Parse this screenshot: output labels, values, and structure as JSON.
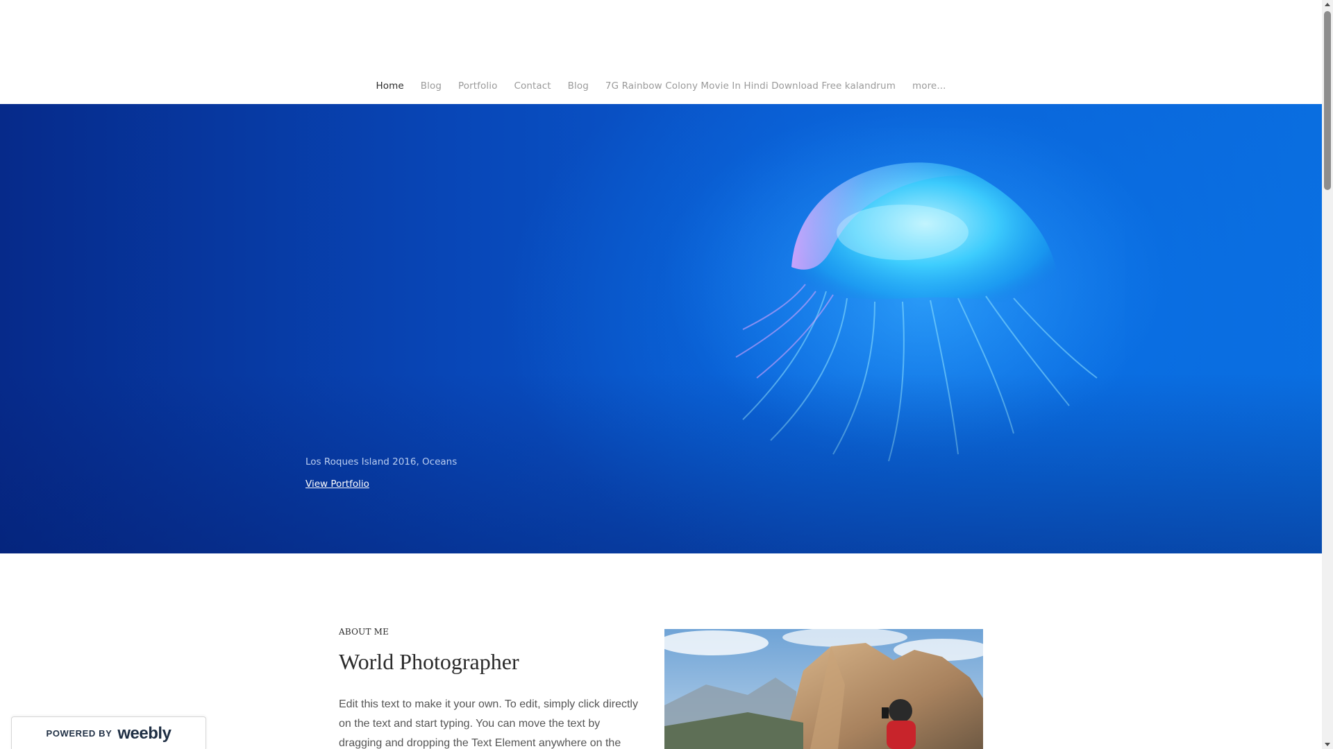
{
  "nav": {
    "items": [
      {
        "label": "Home",
        "active": true
      },
      {
        "label": "Blog",
        "active": false
      },
      {
        "label": "Portfolio",
        "active": false
      },
      {
        "label": "Contact",
        "active": false
      },
      {
        "label": "Blog",
        "active": false
      },
      {
        "label": "7G Rainbow Colony Movie In Hindi Download Free kalandrum",
        "active": false
      },
      {
        "label": "more...",
        "active": false
      }
    ]
  },
  "hero": {
    "caption": "Los Roques Island 2016, Oceans",
    "link_label": "View Portfolio",
    "image_subject": "jellyfish",
    "bg_color": "#0a5ad0"
  },
  "about": {
    "eyebrow": "ABOUT ME",
    "title": "World Photographer",
    "body": "Edit this text to make it your own. To edit, simply click directly on the text and start typing. You can move the text by dragging and dropping the Text Element anywhere on the",
    "photo_subject": "photographer in red jacket facing mountain cliffs"
  },
  "badge": {
    "prefix": "POWERED BY",
    "logo": "weebly"
  },
  "colors": {
    "nav_active": "#2b2b2b",
    "nav_inactive": "#9a9a9a",
    "heading": "#2a2a2a",
    "body_text": "#555555"
  }
}
